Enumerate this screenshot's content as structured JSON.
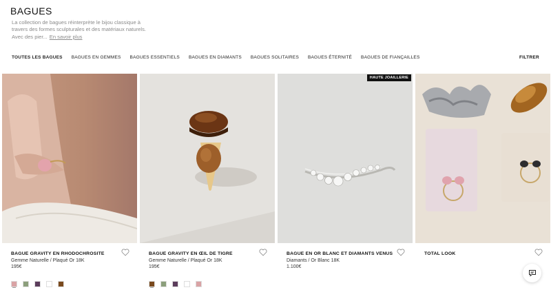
{
  "page": {
    "title": "BAGUES",
    "description": "La collection de bagues réinterprète le bijou classique à travers des formes sculpturales et des matériaux naturels. Avec des pier...",
    "read_more": "En savoir plus"
  },
  "filters": {
    "tabs": [
      {
        "label": "TOUTES LES BAGUES",
        "active": true
      },
      {
        "label": "BAGUES EN GEMMES",
        "active": false
      },
      {
        "label": "BAGUES ESSENTIELS",
        "active": false
      },
      {
        "label": "BAGUES EN DIAMANTS",
        "active": false
      },
      {
        "label": "BAGUES SOLITAIRES",
        "active": false
      },
      {
        "label": "BAGUES ÉTERNITÉ",
        "active": false
      },
      {
        "label": "BAGUES DE FIANÇAILLES",
        "active": false
      }
    ],
    "filter_button": "FILTRER"
  },
  "products": [
    {
      "name": "BAGUE GRAVITY EN RHODOCHROSITE",
      "material": "Gemme Naturelle / Plaqué Or 18K",
      "price": "195€",
      "badge": "",
      "swatches": [
        "#d9a3a5",
        "#8c9f7c",
        "#5c3d5c",
        "#ffffff",
        "#7a4a1e"
      ]
    },
    {
      "name": "BAGUE GRAVITY EN ŒIL DE TIGRE",
      "material": "Gemme Naturelle / Plaqué Or 18K",
      "price": "195€",
      "badge": "",
      "swatches": [
        "#7a4a1e",
        "#8c9f7c",
        "#5c3d5c",
        "#ffffff",
        "#d9a3a5"
      ]
    },
    {
      "name": "BAGUE EN OR BLANC ET DIAMANTS VENUS",
      "material": "Diamants / Or Blanc 18K",
      "price": "1.100€",
      "badge": "HAUTE JOAILLERIE",
      "swatches": []
    },
    {
      "name": "TOTAL LOOK",
      "material": "",
      "price": "",
      "badge": "",
      "swatches": []
    }
  ],
  "icons": {
    "wishlist": "heart-outline-icon",
    "chat": "chat-bubble-icon"
  }
}
